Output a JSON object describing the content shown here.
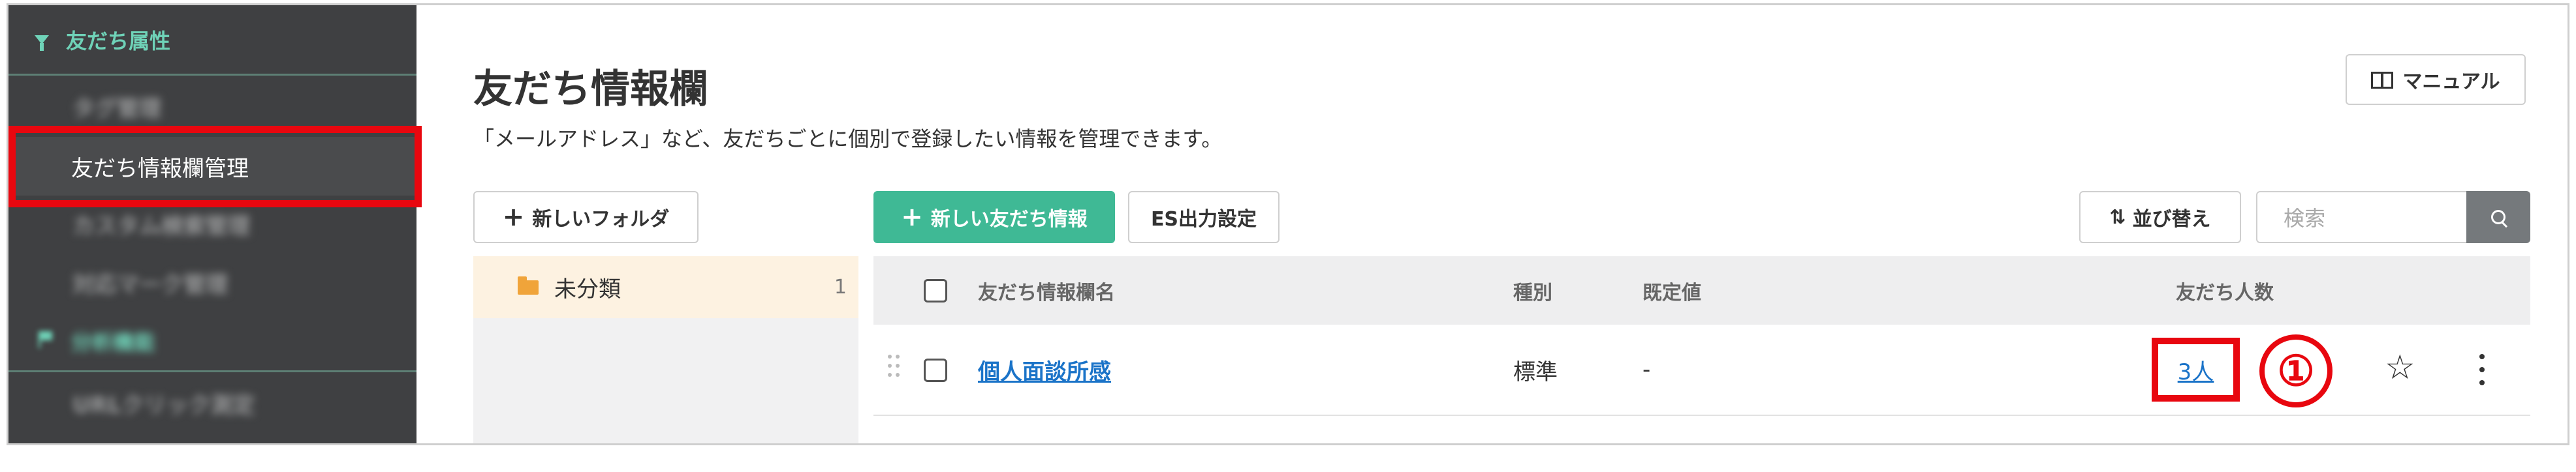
{
  "sidebar": {
    "section_label": "友だち属性",
    "items": [
      {
        "label": "タグ管理",
        "active": false
      },
      {
        "label": "友だち情報欄管理",
        "active": true
      },
      {
        "label": "カスタム検索管理",
        "active": false
      },
      {
        "label": "対応マーク管理",
        "active": false
      }
    ],
    "section2_label": "分析機能",
    "item_after_section2": "URLクリック測定"
  },
  "header": {
    "title": "友だち情報欄",
    "description": "「メールアドレス」など、友だちごとに個別で登録したい情報を管理できます。",
    "manual_label": "マニュアル"
  },
  "toolbar": {
    "new_folder_label": "新しいフォルダ",
    "new_friend_info_label": "新しい友だち情報",
    "es_export_label": "ES出力設定",
    "sort_label": "並び替え",
    "search_placeholder": "検索"
  },
  "folders": [
    {
      "name": "未分類",
      "count": "1"
    }
  ],
  "table": {
    "columns": {
      "name": "友だち情報欄名",
      "type": "種別",
      "default": "既定値",
      "friends": "友だち人数"
    },
    "rows": [
      {
        "name": "個人面談所感",
        "type": "標準",
        "default": "-",
        "friends": "3人"
      }
    ]
  },
  "annotation": {
    "marker": "①"
  },
  "colors": {
    "primary": "#3fb995",
    "sidebar_bg": "#3f4042",
    "sidebar_accent": "#6fd3b8",
    "highlight": "#e8070f",
    "link": "#1a73c8"
  }
}
